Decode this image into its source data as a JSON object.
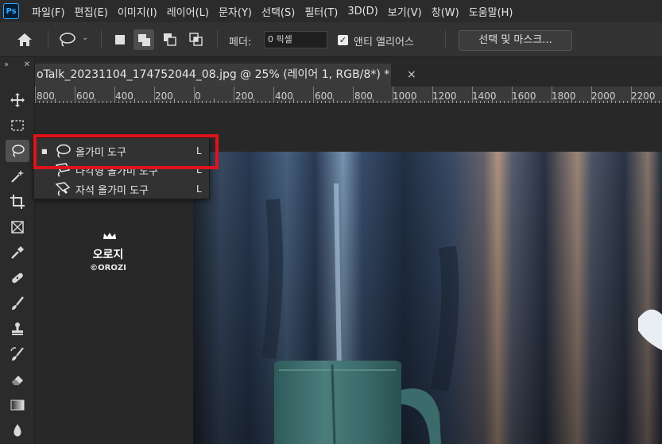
{
  "app": {
    "logo": "Ps",
    "menu": [
      "파일(F)",
      "편집(E)",
      "이미지(I)",
      "레이어(L)",
      "문자(Y)",
      "선택(S)",
      "필터(T)",
      "3D(D)",
      "보기(V)",
      "창(W)",
      "도움말(H)"
    ]
  },
  "options_bar": {
    "feather_label": "페더:",
    "feather_value": "0 픽셀",
    "antialias_label": "앤티 앨리어스",
    "antialias_checked": "✓",
    "select_mask_label": "선택 및 마스크..."
  },
  "toolbar": {
    "collapse": "»",
    "close": "✕"
  },
  "document": {
    "tab_title": "oTalk_20231104_174752044_08.jpg @ 25% (레이어 1, RGB/8*) *",
    "tab_close": "×"
  },
  "ruler": {
    "labels": [
      "800",
      "600",
      "400",
      "200",
      "0",
      "200",
      "400",
      "600",
      "800",
      "1000",
      "1200",
      "1400",
      "1600",
      "1800",
      "2000",
      "2200"
    ]
  },
  "flyout": {
    "items": [
      {
        "label": "올가미 도구",
        "shortcut": "L",
        "bullet": "■",
        "icon": "lasso-icon"
      },
      {
        "label": "다각형 올가미 도구",
        "shortcut": "L",
        "icon": "polygonal-lasso-icon"
      },
      {
        "label": "자석 올가미 도구",
        "shortcut": "L",
        "icon": "magnetic-lasso-icon"
      }
    ]
  },
  "watermark": {
    "name": "오로지",
    "sub": "©OROZI"
  },
  "colors": {
    "highlight": "#e0121c",
    "ps_blue": "#31a8ff"
  }
}
